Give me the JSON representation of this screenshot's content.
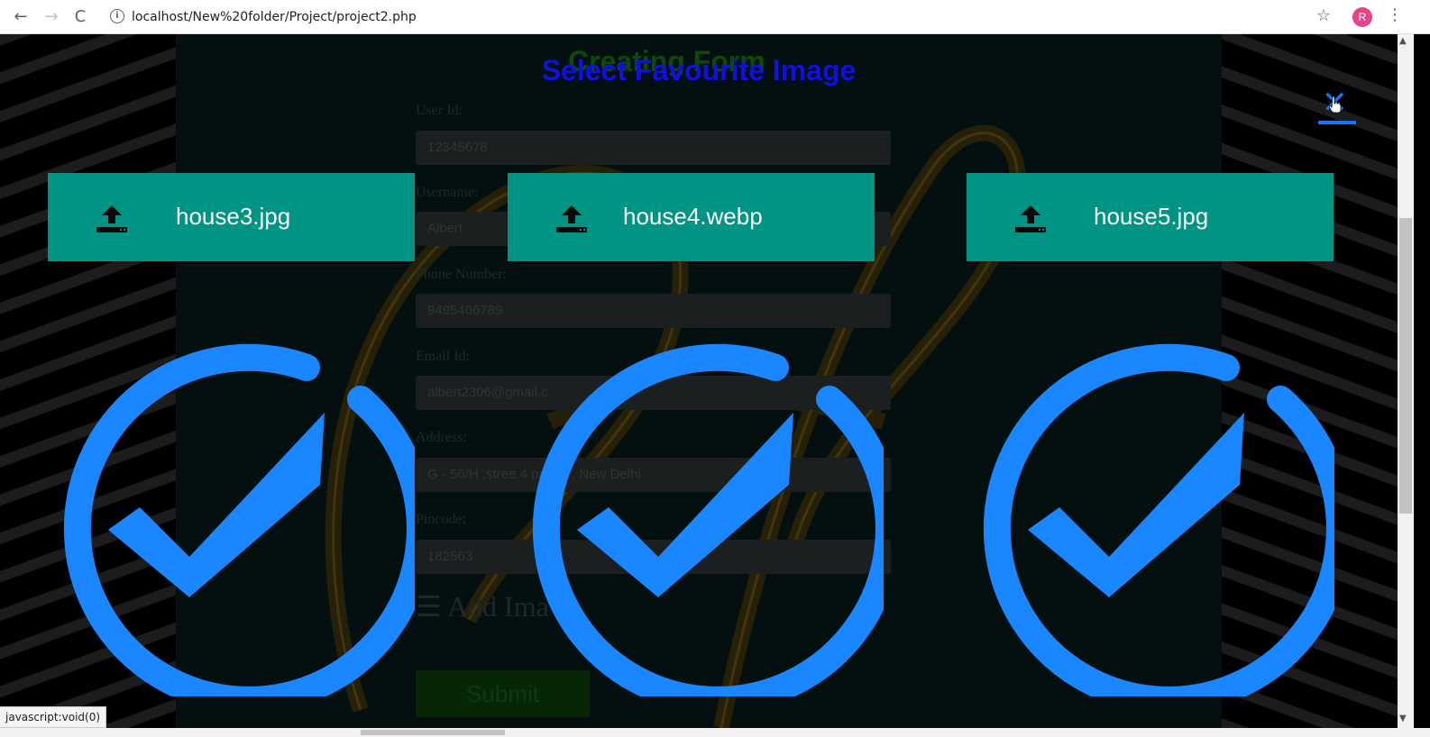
{
  "browser": {
    "url": "localhost/New%20folder/Project/project2.php",
    "back_icon": "←",
    "forward_icon": "→",
    "reload_icon": "C",
    "info_icon": "i",
    "star_icon": "☆",
    "profile_initial": "R",
    "menu_icon": "⋮"
  },
  "form": {
    "title": "Creating Form",
    "fields": [
      {
        "label": "User Id:",
        "value": "12345678"
      },
      {
        "label": "Username:",
        "value": "Albert"
      },
      {
        "label": "Phone Number:",
        "value": "9495466789"
      },
      {
        "label": "Email Id:",
        "value": "albert2306@gmail.c"
      },
      {
        "label": "Address:",
        "value": "G - 56/H ,stree   4 palam , New Delhi"
      },
      {
        "label": "Pincode:",
        "value": "182563"
      }
    ],
    "add_image": "☰ Add Ima",
    "submit": "Submit"
  },
  "overlay": {
    "title": "Select Favourite Image",
    "close_icon": "✕",
    "files": [
      {
        "name": "house3.jpg"
      },
      {
        "name": "house4.webp"
      },
      {
        "name": "house5.jpg"
      }
    ],
    "accent_color": "#1a86ff",
    "card_color": "#009485"
  },
  "statusbar": {
    "text": "javascript:void(0)"
  }
}
